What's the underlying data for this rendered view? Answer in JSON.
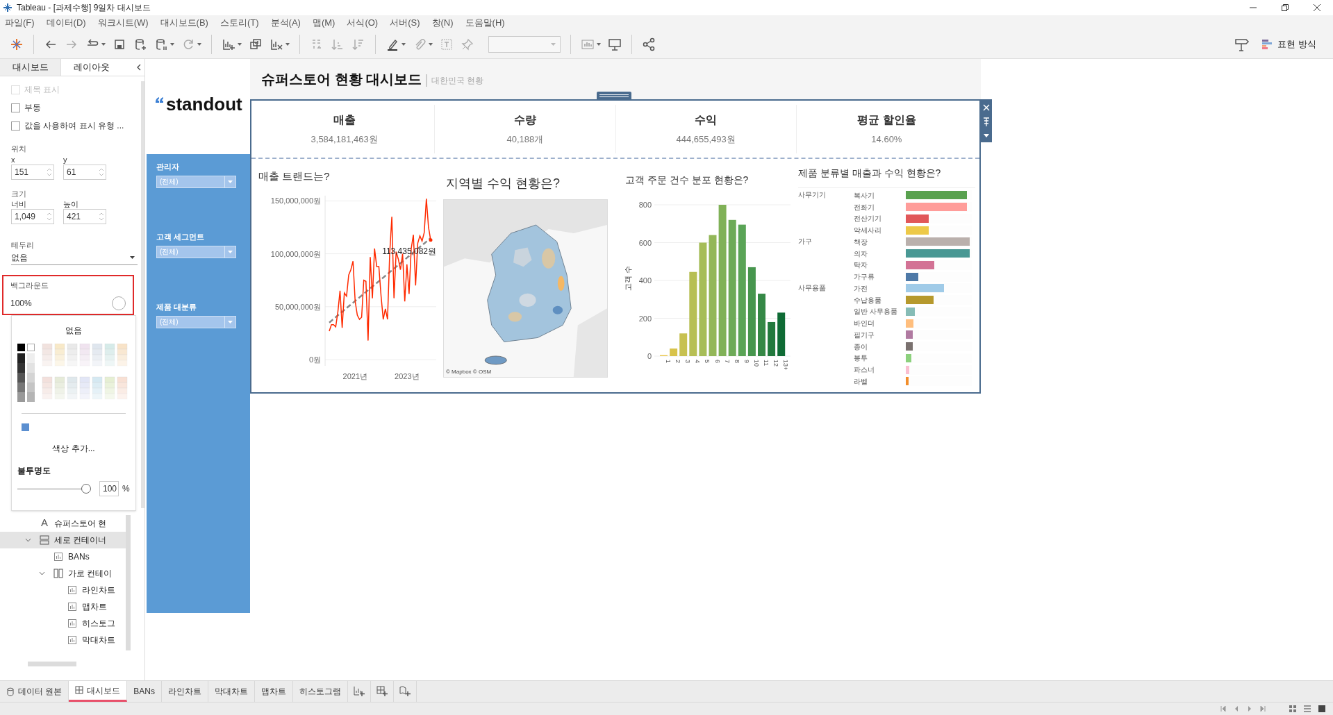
{
  "window": {
    "title": "Tableau - [과제수행] 9일차 대시보드"
  },
  "menu": [
    "파일(F)",
    "데이터(D)",
    "워크시트(W)",
    "대시보드(B)",
    "스토리(T)",
    "분석(A)",
    "맵(M)",
    "서식(O)",
    "서버(S)",
    "창(N)",
    "도움말(H)"
  ],
  "toolbar": {
    "show_me_label": "표현 방식"
  },
  "side_panel": {
    "tabs": [
      {
        "label": "대시보드",
        "selected": false
      },
      {
        "label": "레이아웃",
        "selected": true
      }
    ],
    "options": [
      {
        "label": "제목 표시",
        "checked": false,
        "disabled": true
      },
      {
        "label": "부동",
        "checked": false,
        "disabled": false
      },
      {
        "label": "값을 사용하여 표시 유형 ...",
        "checked": false,
        "disabled": false
      }
    ],
    "position": {
      "label": "위치",
      "fields": [
        {
          "label": "x",
          "value": "151"
        },
        {
          "label": "y",
          "value": "61"
        }
      ]
    },
    "size": {
      "label": "크기",
      "fields": [
        {
          "label": "너비",
          "value": "1,049"
        },
        {
          "label": "높이",
          "value": "421"
        }
      ]
    },
    "border": {
      "label": "테두리",
      "value": "없음"
    },
    "background": {
      "label": "백그라운드",
      "value": "100%"
    },
    "color_popup": {
      "none_label": "없음",
      "add_color": "색상 추가...",
      "opacity_label": "불투명도",
      "opacity": {
        "level": 1,
        "value": "100",
        "unit": "%"
      }
    },
    "tree": [
      {
        "label": "슈퍼스토어 현",
        "kind": "text",
        "icon": "A",
        "selected": false
      },
      {
        "label": "세로 컨테이너",
        "kind": "vertical",
        "expanded": true,
        "selected": true,
        "children": [
          {
            "label": "BANs",
            "kind": "sheet",
            "selected": false
          },
          {
            "label": "가로 컨테이",
            "kind": "horizontal",
            "expanded": true,
            "selected": false,
            "children": [
              {
                "label": "라인차트",
                "kind": "sheet",
                "selected": false
              },
              {
                "label": "맵차트",
                "kind": "sheet",
                "selected": false
              },
              {
                "label": "히스토그",
                "kind": "sheet",
                "selected": false
              },
              {
                "label": "막대차트",
                "kind": "sheet",
                "selected": false
              }
            ]
          }
        ]
      }
    ]
  },
  "dashboard": {
    "logo": "standout",
    "title": "슈퍼스토어 현황 대시보드",
    "subtitle": "대한민국 현황",
    "filters": [
      {
        "label": "관리자",
        "value": "(전체)"
      },
      {
        "label": "고객 세그먼트",
        "value": "(전체)"
      },
      {
        "label": "제품 대분류",
        "value": "(전체)"
      }
    ],
    "bans": [
      {
        "label": "매출",
        "value": "3,584,181,463원"
      },
      {
        "label": "수량",
        "value": "40,188개"
      },
      {
        "label": "수익",
        "value": "444,655,493원"
      },
      {
        "label": "평균 할인율",
        "value": "14.60%"
      }
    ],
    "line_chart": {
      "chart_data": {
        "type": "line",
        "title": "매출 트랜드는?",
        "categories": [
          null,
          null,
          null,
          null,
          null,
          null,
          null,
          null,
          null,
          null,
          null,
          null,
          "2021년",
          null,
          null,
          null,
          null,
          null,
          null,
          null,
          null,
          null,
          null,
          null,
          null,
          null,
          null,
          null,
          null,
          null,
          null,
          null,
          null,
          null,
          null,
          null,
          "2023년",
          null,
          null,
          null,
          null,
          null,
          null,
          null,
          null,
          null,
          null,
          null
        ],
        "series": [
          {
            "color": "#ff2a00",
            "values": [
              27000000,
              33000000,
              33000000,
              31000000,
              45000000,
              65000000,
              30000000,
              63000000,
              60000000,
              80000000,
              85000000,
              93000000,
              55000000,
              42000000,
              38000000,
              40000000,
              75000000,
              74000000,
              18000000,
              97000000,
              58000000,
              105000000,
              88000000,
              88000000,
              60000000,
              38000000,
              48000000,
              38000000,
              100000000,
              135000000,
              58000000,
              102000000,
              95000000,
              85000000,
              100000000,
              55000000,
              90000000,
              62000000,
              105000000,
              118000000,
              70000000,
              110000000,
              117000000,
              112000000,
              120000000,
              152000000,
              125000000,
              113000000
            ]
          },
          {
            "color": "#888888",
            "line_style": "dashed",
            "values": [
              35000000,
              36700000,
              38400000,
              40100000,
              41800000,
              43500000,
              45200000,
              46900000,
              48600000,
              50300000,
              52000000,
              53700000,
              55400000,
              57100000,
              58800000,
              60500000,
              62200000,
              63900000,
              65600000,
              67300000,
              69000000,
              70700000,
              72400000,
              74100000,
              75800000,
              77500000,
              79200000,
              80900000,
              82600000,
              84300000,
              86000000,
              87700000,
              89400000,
              91100000,
              92800000,
              94500000,
              96200000,
              97900000,
              99600000,
              101300000,
              103000000,
              104700000,
              106400000,
              108100000,
              109800000,
              111500000,
              113200000,
              114900000
            ]
          }
        ],
        "ylim": [
          0,
          155000000
        ],
        "grid": true,
        "yticks": [
          {
            "value": 0,
            "label": "0원"
          },
          {
            "value": 50000000,
            "label": "50,000,000원"
          },
          {
            "value": 100000000,
            "label": "100,000,000원"
          },
          {
            "value": 150000000,
            "label": "150,000,000원"
          }
        ],
        "annotations": [
          {
            "text": "113,435,082원"
          }
        ]
      }
    },
    "map": {
      "title": "지역별 수익 현황은?",
      "attribution": "© Mapbox © OSM"
    },
    "histogram": {
      "chart_data": {
        "type": "bar",
        "title": "고객 주문 건수 분포 현황은?",
        "ylabel": "고객 수",
        "categories": [
          "1",
          "2",
          "3",
          "4",
          "5",
          "6",
          "7",
          "8",
          "9",
          "10",
          "11",
          "12",
          "13+"
        ],
        "values": [
          5,
          40,
          120,
          445,
          600,
          640,
          800,
          720,
          695,
          470,
          330,
          180,
          230
        ],
        "ylim": [
          0,
          800
        ],
        "grid": true,
        "yticks": [
          0,
          200,
          400,
          600,
          800
        ]
      }
    },
    "product_chart": {
      "title": "제품 분류별 매출과 수익 현황은?",
      "groups": [
        {
          "label": "사무기기",
          "items": [
            {
              "label": "복사기",
              "level": 0.96,
              "color": "#59a14f"
            },
            {
              "label": "전화기",
              "level": 0.96,
              "color": "#ff9d9a"
            },
            {
              "label": "전산기기",
              "level": 0.36,
              "color": "#e15759"
            },
            {
              "label": "악세사리",
              "level": 0.36,
              "color": "#edc948"
            }
          ]
        },
        {
          "label": "가구",
          "items": [
            {
              "label": "책장",
              "level": 1,
              "color": "#bab0ac"
            },
            {
              "label": "의자",
              "level": 1,
              "color": "#499894"
            },
            {
              "label": "탁자",
              "level": 0.45,
              "color": "#d37295"
            },
            {
              "label": "가구류",
              "level": 0.2,
              "color": "#4e79a7"
            }
          ]
        },
        {
          "label": "사무용품",
          "items": [
            {
              "label": "가전",
              "level": 0.6,
              "color": "#a0cbe8"
            },
            {
              "label": "수납용품",
              "level": 0.43,
              "color": "#b6992d"
            },
            {
              "label": "일반 사무용품",
              "level": 0.14,
              "color": "#86bcb6"
            },
            {
              "label": "바인더",
              "level": 0.12,
              "color": "#ffbe7d"
            },
            {
              "label": "필기구",
              "level": 0.11,
              "color": "#b07aa1"
            },
            {
              "label": "종이",
              "level": 0.11,
              "color": "#79706e"
            },
            {
              "label": "봉투",
              "level": 0.09,
              "color": "#8cd17d"
            },
            {
              "label": "파스너",
              "level": 0.05,
              "color": "#fabfd2"
            },
            {
              "label": "라벨",
              "level": 0.04,
              "color": "#f28e2b"
            }
          ]
        }
      ]
    }
  },
  "bottom_tabs": [
    {
      "label": "데이터 원본",
      "kind": "data",
      "selected": false
    },
    {
      "label": "대시보드",
      "kind": "dashboard",
      "selected": true
    },
    {
      "label": "BANs",
      "kind": "sheet",
      "selected": false
    },
    {
      "label": "라인차트",
      "kind": "sheet",
      "selected": false
    },
    {
      "label": "막대차트",
      "kind": "sheet",
      "selected": false
    },
    {
      "label": "맵차트",
      "kind": "sheet",
      "selected": false
    },
    {
      "label": "히스토그램",
      "kind": "sheet",
      "selected": false
    }
  ]
}
